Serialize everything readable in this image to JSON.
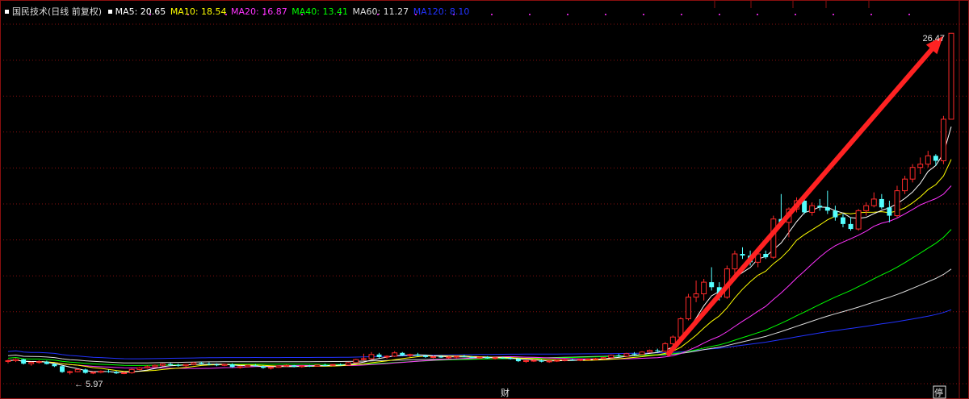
{
  "header": {
    "title": "国民技术(日线 前复权)"
  },
  "ma_legend": [
    {
      "label": "MA5: 20.65",
      "color": "#ffffff"
    },
    {
      "label": "MA10: 18.54",
      "color": "#ffff00"
    },
    {
      "label": "MA20: 16.87",
      "color": "#ff33ff"
    },
    {
      "label": "MA40: 13.41",
      "color": "#00ff00"
    },
    {
      "label": "MA60: 11.27",
      "color": "#dddddd"
    },
    {
      "label": "MA120: 8.10",
      "color": "#2233ff"
    }
  ],
  "colors": {
    "background": "#000000",
    "up": "#ff2a2a",
    "down": "#54ffff",
    "grid": "#8a0f0f",
    "arrow": "#ff2222",
    "marker": "#cc22cc"
  },
  "chart_data": {
    "type": "candlestick",
    "title": "国民技术(日线 前复权)",
    "ylim": [
      5.3,
      27.5
    ],
    "grid": true,
    "price_labels": {
      "high": "26.47",
      "low": "5.97"
    },
    "bottom_markers": [
      "财",
      "停"
    ],
    "annotations": [
      "red arrow from the start of the rally to the 26.47 peak"
    ],
    "ma_series": [
      {
        "name": "MA5",
        "last": 20.65
      },
      {
        "name": "MA10",
        "last": 18.54
      },
      {
        "name": "MA20",
        "last": 16.87
      },
      {
        "name": "MA40",
        "last": 13.41
      },
      {
        "name": "MA60",
        "last": 11.27
      },
      {
        "name": "MA120",
        "last": 8.1
      }
    ],
    "candles": [
      [
        6.75,
        6.85,
        6.62,
        6.78
      ],
      [
        6.78,
        6.92,
        6.7,
        6.86
      ],
      [
        6.86,
        6.9,
        6.55,
        6.6
      ],
      [
        6.6,
        6.72,
        6.48,
        6.68
      ],
      [
        6.68,
        6.8,
        6.6,
        6.72
      ],
      [
        6.72,
        6.78,
        6.55,
        6.58
      ],
      [
        6.58,
        6.62,
        6.4,
        6.45
      ],
      [
        6.45,
        6.5,
        6.05,
        6.1
      ],
      [
        6.1,
        6.18,
        5.95,
        6.12
      ],
      [
        6.12,
        6.3,
        6.08,
        6.25
      ],
      [
        6.25,
        6.3,
        6.0,
        6.05
      ],
      [
        6.05,
        6.12,
        5.97,
        6.08
      ],
      [
        6.08,
        6.2,
        6.02,
        6.15
      ],
      [
        6.15,
        6.25,
        6.05,
        6.1
      ],
      [
        6.1,
        6.18,
        5.98,
        6.02
      ],
      [
        6.02,
        6.1,
        5.97,
        6.05
      ],
      [
        6.05,
        6.3,
        6.0,
        6.25
      ],
      [
        6.25,
        6.4,
        6.2,
        6.35
      ],
      [
        6.35,
        6.5,
        6.3,
        6.42
      ],
      [
        6.42,
        6.55,
        6.35,
        6.5
      ],
      [
        6.5,
        6.62,
        6.45,
        6.58
      ],
      [
        6.58,
        6.65,
        6.48,
        6.52
      ],
      [
        6.52,
        6.6,
        6.42,
        6.48
      ],
      [
        6.48,
        6.58,
        6.4,
        6.55
      ],
      [
        6.55,
        6.7,
        6.5,
        6.65
      ],
      [
        6.65,
        6.72,
        6.55,
        6.6
      ],
      [
        6.6,
        6.68,
        6.5,
        6.55
      ],
      [
        6.55,
        6.62,
        6.45,
        6.5
      ],
      [
        6.5,
        6.6,
        6.45,
        6.56
      ],
      [
        6.56,
        6.62,
        6.35,
        6.4
      ],
      [
        6.4,
        6.48,
        6.3,
        6.42
      ],
      [
        6.42,
        6.55,
        6.38,
        6.5
      ],
      [
        6.5,
        6.58,
        6.42,
        6.45
      ],
      [
        6.45,
        6.5,
        6.3,
        6.35
      ],
      [
        6.35,
        6.42,
        6.25,
        6.38
      ],
      [
        6.38,
        6.5,
        6.35,
        6.46
      ],
      [
        6.46,
        6.55,
        6.4,
        6.5
      ],
      [
        6.5,
        6.52,
        6.38,
        6.42
      ],
      [
        6.42,
        6.5,
        6.36,
        6.47
      ],
      [
        6.47,
        6.52,
        6.4,
        6.45
      ],
      [
        6.45,
        6.55,
        6.42,
        6.52
      ],
      [
        6.52,
        6.6,
        6.45,
        6.5
      ],
      [
        6.5,
        6.58,
        6.44,
        6.55
      ],
      [
        6.55,
        6.62,
        6.48,
        6.52
      ],
      [
        6.52,
        6.7,
        6.5,
        6.66
      ],
      [
        6.66,
        6.9,
        6.62,
        6.85
      ],
      [
        6.85,
        7.2,
        6.8,
        6.9
      ],
      [
        6.9,
        7.3,
        6.85,
        7.15
      ],
      [
        7.15,
        7.25,
        6.95,
        7.0
      ],
      [
        7.0,
        7.1,
        6.9,
        7.05
      ],
      [
        7.05,
        7.35,
        7.0,
        7.25
      ],
      [
        7.25,
        7.3,
        7.05,
        7.1
      ],
      [
        7.1,
        7.2,
        7.0,
        7.15
      ],
      [
        7.15,
        7.25,
        7.05,
        7.08
      ],
      [
        7.08,
        7.15,
        6.95,
        7.0
      ],
      [
        7.0,
        7.08,
        6.92,
        7.02
      ],
      [
        7.02,
        7.1,
        6.95,
        6.98
      ],
      [
        6.98,
        7.05,
        6.9,
        7.0
      ],
      [
        7.0,
        7.08,
        6.93,
        7.04
      ],
      [
        7.04,
        7.12,
        6.98,
        7.0
      ],
      [
        7.0,
        7.06,
        6.92,
        6.95
      ],
      [
        6.95,
        7.02,
        6.88,
        6.99
      ],
      [
        6.99,
        7.05,
        6.9,
        6.93
      ],
      [
        6.93,
        7.0,
        6.85,
        6.96
      ],
      [
        6.96,
        7.02,
        6.9,
        6.94
      ],
      [
        6.94,
        7.0,
        6.85,
        6.88
      ],
      [
        6.88,
        6.95,
        6.7,
        6.75
      ],
      [
        6.75,
        6.82,
        6.65,
        6.78
      ],
      [
        6.78,
        6.85,
        6.7,
        6.8
      ],
      [
        6.8,
        6.85,
        6.68,
        6.72
      ],
      [
        6.72,
        6.8,
        6.65,
        6.76
      ],
      [
        6.76,
        6.85,
        6.7,
        6.8
      ],
      [
        6.8,
        6.88,
        6.74,
        6.84
      ],
      [
        6.84,
        6.9,
        6.78,
        6.82
      ],
      [
        6.82,
        6.88,
        6.75,
        6.85
      ],
      [
        6.85,
        6.92,
        6.8,
        6.88
      ],
      [
        6.88,
        6.95,
        6.82,
        6.9
      ],
      [
        6.9,
        7.0,
        6.86,
        6.96
      ],
      [
        6.96,
        7.15,
        6.92,
        7.1
      ],
      [
        7.1,
        7.2,
        7.0,
        7.05
      ],
      [
        7.05,
        7.25,
        7.0,
        7.2
      ],
      [
        7.2,
        7.3,
        7.1,
        7.15
      ],
      [
        7.15,
        7.35,
        7.12,
        7.3
      ],
      [
        7.3,
        7.45,
        7.25,
        7.4
      ],
      [
        7.4,
        7.5,
        7.3,
        7.35
      ],
      [
        7.35,
        7.9,
        7.3,
        7.8
      ],
      [
        7.8,
        8.3,
        7.7,
        8.2
      ],
      [
        8.2,
        9.4,
        8.1,
        9.3
      ],
      [
        9.3,
        10.8,
        9.2,
        10.6
      ],
      [
        10.6,
        11.6,
        10.3,
        10.8
      ],
      [
        10.8,
        11.7,
        10.4,
        11.5
      ],
      [
        11.5,
        12.4,
        11.0,
        11.2
      ],
      [
        11.2,
        11.5,
        10.4,
        10.6
      ],
      [
        10.6,
        12.5,
        10.5,
        12.3
      ],
      [
        12.3,
        13.4,
        12.0,
        13.2
      ],
      [
        13.2,
        13.6,
        12.9,
        13.1
      ],
      [
        13.1,
        13.4,
        12.5,
        12.7
      ],
      [
        12.7,
        13.3,
        12.4,
        13.2
      ],
      [
        13.2,
        13.4,
        12.9,
        13.0
      ],
      [
        13.0,
        15.5,
        12.9,
        15.3
      ],
      [
        15.3,
        16.8,
        15.0,
        15.1
      ],
      [
        15.1,
        16.0,
        14.2,
        15.9
      ],
      [
        15.9,
        16.6,
        15.7,
        16.4
      ],
      [
        16.4,
        16.8,
        15.6,
        15.7
      ],
      [
        15.7,
        16.3,
        15.5,
        16.1
      ],
      [
        16.1,
        16.5,
        15.8,
        16.0
      ],
      [
        16.0,
        17.0,
        15.6,
        15.8
      ],
      [
        15.8,
        16.1,
        15.2,
        15.4
      ],
      [
        15.4,
        15.6,
        14.8,
        15.0
      ],
      [
        15.0,
        15.4,
        14.6,
        14.7
      ],
      [
        14.7,
        15.9,
        14.6,
        15.8
      ],
      [
        15.8,
        16.3,
        15.5,
        16.1
      ],
      [
        16.1,
        16.9,
        16.0,
        16.5
      ],
      [
        16.5,
        16.8,
        15.9,
        16.0
      ],
      [
        16.0,
        16.4,
        15.1,
        15.5
      ],
      [
        15.5,
        17.3,
        15.4,
        17.0
      ],
      [
        17.0,
        17.9,
        16.8,
        17.7
      ],
      [
        17.7,
        18.6,
        17.5,
        18.4
      ],
      [
        18.4,
        19.0,
        18.0,
        18.6
      ],
      [
        18.6,
        19.4,
        18.4,
        19.1
      ],
      [
        19.1,
        19.2,
        18.5,
        18.8
      ],
      [
        18.8,
        21.5,
        18.6,
        21.3
      ],
      [
        21.3,
        26.47,
        21.3,
        26.47
      ]
    ]
  }
}
